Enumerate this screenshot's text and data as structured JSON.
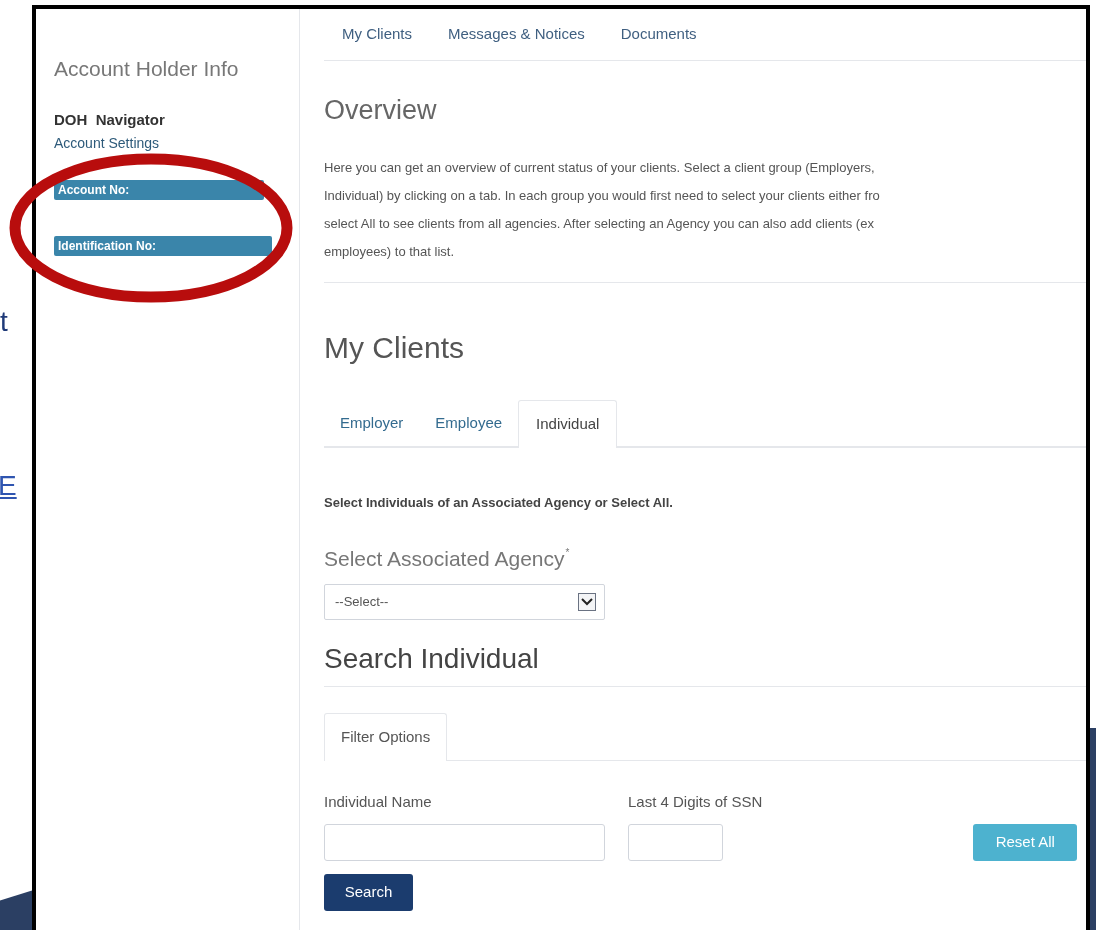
{
  "slide_fragments": [
    {
      "text": "t",
      "kind": "plain"
    },
    {
      "text": "E",
      "kind": "link"
    }
  ],
  "sidebar": {
    "title": "Account Holder Info",
    "user_name": "DOH  Navigator",
    "settings_link": "Account Settings",
    "info_bars": [
      "Account No:",
      "Identification No:"
    ]
  },
  "top_tabs": [
    {
      "label": "My Clients",
      "selected": false
    },
    {
      "label": "Messages & Notices",
      "selected": false
    },
    {
      "label": "Documents",
      "selected": false
    }
  ],
  "overview": {
    "heading": "Overview",
    "lines": [
      "Here you can get an overview of current status of your clients. Select a client group (Employers,",
      "Individual) by clicking on a tab. In each group you would first need to select your clients either fro",
      "select All to see clients from all agencies. After selecting an Agency you can also add clients (ex",
      "employees) to that list."
    ]
  },
  "my_clients": {
    "heading": "My Clients",
    "tabs": [
      {
        "label": "Employer",
        "selected": false
      },
      {
        "label": "Employee",
        "selected": false
      },
      {
        "label": "Individual",
        "selected": true
      }
    ],
    "instruction": "Select Individuals of an Associated Agency or Select All.",
    "agency_label": "Select Associated Agency",
    "agency_required_mark": "*",
    "agency_select": {
      "value": "--Select--"
    }
  },
  "search_individual": {
    "heading": "Search Individual",
    "tabs": [
      {
        "label": "Filter Options",
        "selected": true
      }
    ],
    "fields": [
      {
        "label": "Individual Name"
      },
      {
        "label": "Last 4 Digits of SSN"
      }
    ],
    "reset_button": "Reset All",
    "search_button": "Search"
  }
}
